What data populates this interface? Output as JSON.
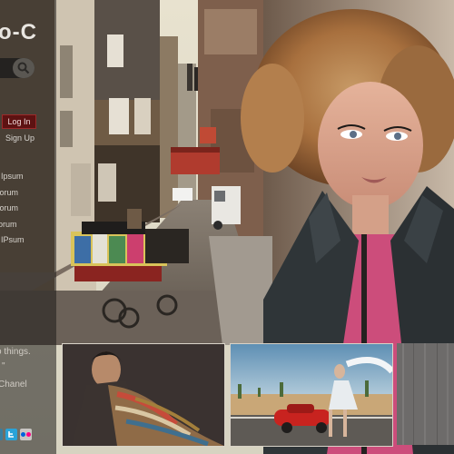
{
  "site": {
    "logo_text": "o-C"
  },
  "search": {
    "icon": "magnifier-icon"
  },
  "auth": {
    "login_label": "Log In",
    "signup_label": "Sign Up"
  },
  "menu": {
    "items": [
      {
        "label": "em Ipsum"
      },
      {
        "label": "Dolorum"
      },
      {
        "label": "Dolorum"
      },
      {
        "label": "dolorum"
      },
      {
        "label": "em IPsum"
      }
    ]
  },
  "quote": {
    "text": "o things.",
    "mark": "\"",
    "author": "Chanel"
  },
  "social": {
    "icons": [
      "social-icon",
      "twitter-icon",
      "flickr-icon"
    ]
  },
  "thumbnails": [
    {
      "icon": "photo-fashion-scarves"
    },
    {
      "icon": "photo-red-car-desert"
    },
    {
      "icon": "photo-grey-texture"
    }
  ],
  "colors": {
    "login_bg": "#5d1212",
    "sidebar_overlay": "rgba(30,28,26,0.55)",
    "twitter": "#2aa3d8",
    "flickr_blue": "#0063dc",
    "flickr_pink": "#ff0084"
  }
}
